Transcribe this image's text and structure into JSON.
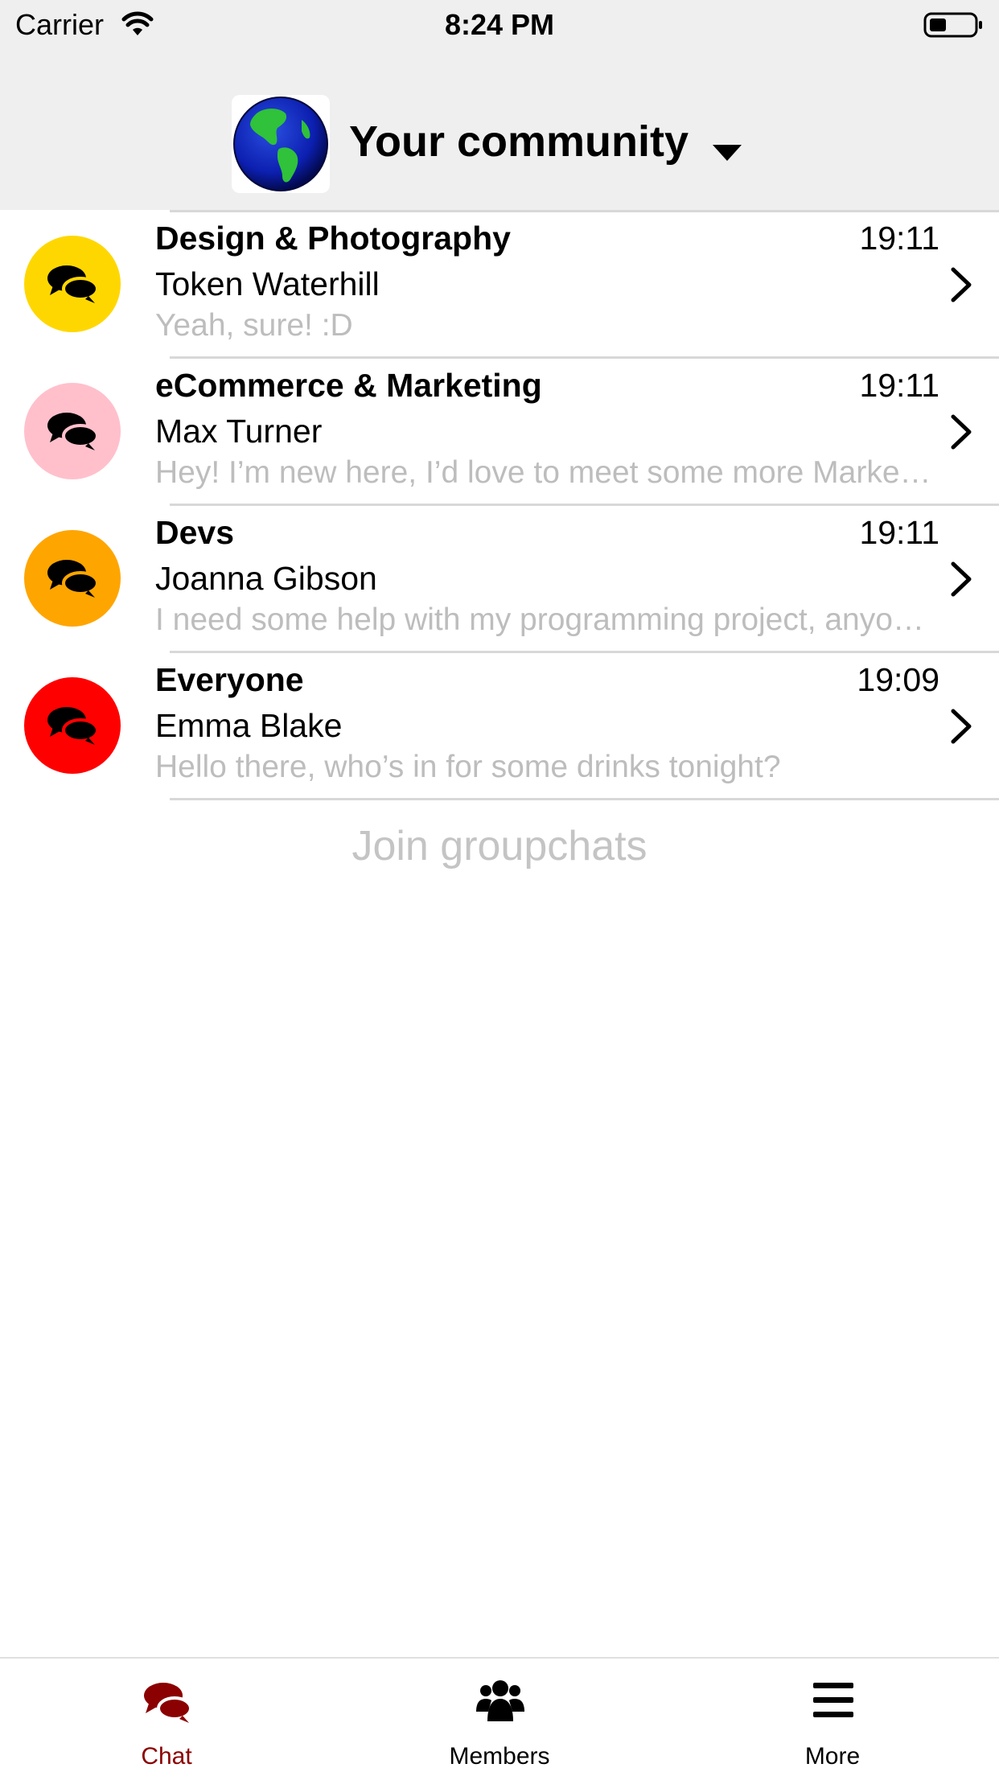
{
  "status_bar": {
    "carrier": "Carrier",
    "time": "8:24 PM",
    "wifi_icon": "wifi-icon",
    "battery_icon": "battery-icon"
  },
  "header": {
    "title": "Your community",
    "logo_icon": "globe-icon",
    "dropdown_icon": "caret-down-icon"
  },
  "chats": [
    {
      "name": "Design & Photography",
      "time": "19:11",
      "sender": "Token Waterhill",
      "preview": "Yeah, sure! :D",
      "color": "#FFD700",
      "icon": "chat-bubbles-icon"
    },
    {
      "name": "eCommerce & Marketing",
      "time": "19:11",
      "sender": "Max Turner",
      "preview": "Hey! I’m new here, I’d love to meet some more Marketers",
      "color": "#FFC0CB",
      "icon": "chat-bubbles-icon"
    },
    {
      "name": "Devs",
      "time": "19:11",
      "sender": "Joanna Gibson",
      "preview": "I need some help with my programming project, anyone?",
      "color": "#FFA500",
      "icon": "chat-bubbles-icon"
    },
    {
      "name": "Everyone",
      "time": "19:09",
      "sender": "Emma Blake",
      "preview": "Hello there, who’s in for some drinks tonight?",
      "color": "#FF0000",
      "icon": "chat-bubbles-icon"
    }
  ],
  "join_label": "Join groupchats",
  "tabs": [
    {
      "label": "Chat",
      "icon": "chat-bubbles-icon",
      "active": true,
      "color": "#8B0000"
    },
    {
      "label": "Members",
      "icon": "users-icon",
      "active": false,
      "color": "#000000"
    },
    {
      "label": "More",
      "icon": "menu-icon",
      "active": false,
      "color": "#000000"
    }
  ]
}
